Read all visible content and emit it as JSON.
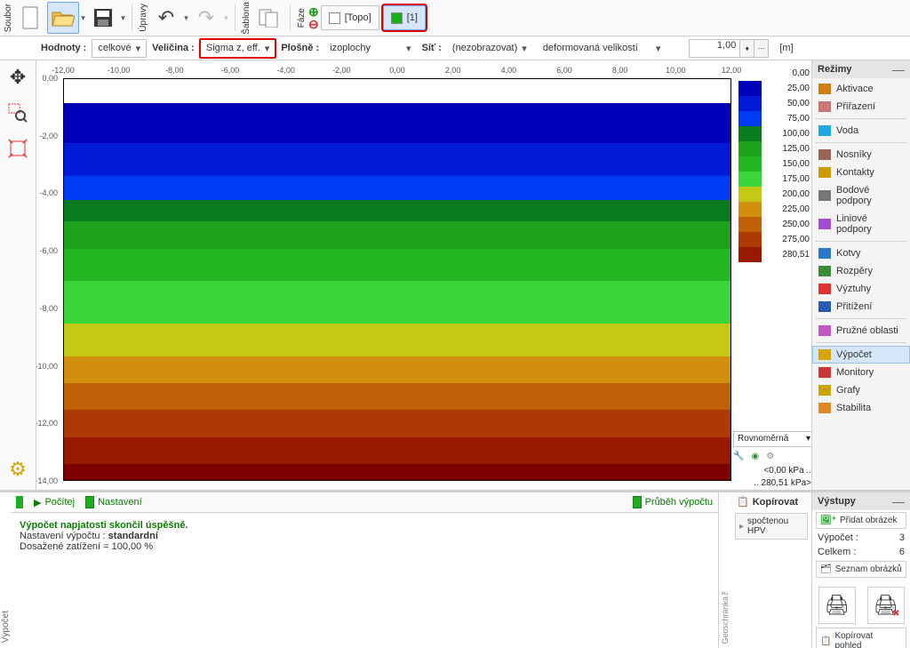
{
  "toolbar": {
    "file_label": "Soubor",
    "edit_label": "Úpravy",
    "template_label": "Šablona",
    "phase_label": "Fáze",
    "phase_topo": "[Topo]",
    "phase_1": "[1]"
  },
  "selectors": {
    "hodnoty_label": "Hodnoty :",
    "hodnoty_value": "celkové",
    "velicina_label": "Veličina :",
    "velicina_value": "Sigma z, eff.",
    "plosne_label": "Plošně :",
    "plosne_value": "izoplochy",
    "sit_label": "Síť :",
    "sit_value": "(nezobrazovat)",
    "deform_value": "deformovaná velikostí",
    "scale_value": "1,00",
    "unit": "[m]"
  },
  "ruler_h": [
    "-12,00",
    "-10,00",
    "-8,00",
    "-6,00",
    "-4,00",
    "-2,00",
    "0,00",
    "2,00",
    "4,00",
    "6,00",
    "8,00",
    "10,00",
    "12,00"
  ],
  "ruler_v": [
    "0,00",
    "-2,00",
    "-4,00",
    "-6,00",
    "-8,00",
    "-10,00",
    "-12,00",
    "-14,00"
  ],
  "chart_data": {
    "type": "heatmap",
    "title": "",
    "xlabel": "[m]",
    "ylabel": "[m]",
    "xlim": [
      -12,
      12
    ],
    "ylim": [
      -14,
      0
    ],
    "value_label": "Sigma z, eff.",
    "value_unit": "kPa",
    "value_range": [
      0,
      280.51
    ],
    "legend_values": [
      0.0,
      25.0,
      50.0,
      75.0,
      100.0,
      125.0,
      150.0,
      175.0,
      200.0,
      225.0,
      250.0,
      275.0,
      280.51
    ],
    "legend_colors": [
      "#0000b8",
      "#001ad6",
      "#003af3",
      "#0a7b1e",
      "#1da21d",
      "#23b723",
      "#3ad63a",
      "#c3c915",
      "#d38e0e",
      "#bd6006",
      "#ad3a04",
      "#991800",
      "#7d0000"
    ],
    "bands": [
      {
        "y0": 0.0,
        "y1": -1.5,
        "color": "#0000b8"
      },
      {
        "y0": -1.5,
        "y1": -2.7,
        "color": "#001ad6"
      },
      {
        "y0": -2.7,
        "y1": -3.6,
        "color": "#003af3"
      },
      {
        "y0": -3.6,
        "y1": -4.4,
        "color": "#0a7b1e"
      },
      {
        "y0": -4.4,
        "y1": -5.4,
        "color": "#1da21d"
      },
      {
        "y0": -5.4,
        "y1": -6.6,
        "color": "#23b723"
      },
      {
        "y0": -6.6,
        "y1": -8.2,
        "color": "#3ad63a"
      },
      {
        "y0": -8.2,
        "y1": -9.4,
        "color": "#c3c915"
      },
      {
        "y0": -9.4,
        "y1": -10.4,
        "color": "#d38e0e"
      },
      {
        "y0": -10.4,
        "y1": -11.4,
        "color": "#bd6006"
      },
      {
        "y0": -11.4,
        "y1": -12.4,
        "color": "#ad3a04"
      },
      {
        "y0": -12.4,
        "y1": -13.4,
        "color": "#991800"
      },
      {
        "y0": -13.4,
        "y1": -14.0,
        "color": "#7d0000"
      }
    ]
  },
  "range_panel": {
    "mode": "Rovnoměrná",
    "min": "<0,00 kPa ..",
    "max": ".. 280,51 kPa>"
  },
  "right_panel": {
    "header": "Režimy",
    "groups": [
      [
        "Aktivace",
        "Přiřazení"
      ],
      [
        "Voda"
      ],
      [
        "Nosníky",
        "Kontakty",
        "Bodové podpory",
        "Liniové podpory"
      ],
      [
        "Kotvy",
        "Rozpěry",
        "Výztuhy",
        "Přitížení"
      ],
      [
        "Pružné oblasti"
      ],
      [
        "Výpočet",
        "Monitory",
        "Grafy",
        "Stabilita"
      ]
    ],
    "active": "Výpočet"
  },
  "bottom": {
    "tab_left": "Výpočet",
    "pocitej": "Počítej",
    "nastaveni": "Nastavení",
    "prubeh": "Průběh výpočtu",
    "log_ok": "Výpočet napjatosti skončil úspěšně.",
    "log_line2a": "Nastavení výpočtu : ",
    "log_line2b": "standardní",
    "log_line3": "Dosažené zatížení = 100,00 %",
    "geoclip": "Geoschránka™",
    "copy_header": "Kopírovat",
    "copy_btn": "spočtenou HPV",
    "outputs_header": "Výstupy",
    "add_image": "Přidat obrázek",
    "vypocet": "Výpočet :",
    "vypocet_n": "3",
    "celkem": "Celkem :",
    "celkem_n": "6",
    "list_images": "Seznam obrázků",
    "copy_view": "Kopírovat pohled"
  }
}
